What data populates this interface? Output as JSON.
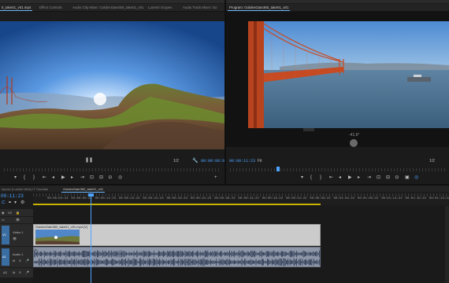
{
  "tabs_left": [
    {
      "label": "0_take01_v01.mp4",
      "active": true
    },
    {
      "label": "Effect Controls",
      "active": false
    },
    {
      "label": "Audio Clip Mixer: GoldenGate360_take01_v01",
      "active": false
    },
    {
      "label": "Lumetri Scopes",
      "active": false
    },
    {
      "label": "Audio Track Mixer: Go",
      "active": false
    }
  ],
  "tab_program": "Program: GoldenGate360_take01_v01",
  "source": {
    "timecode": "00:00:08:09",
    "zoom": "1/2"
  },
  "program": {
    "angle": "-41.6°",
    "timecode": "00:00:11:23",
    "fit": "Fit",
    "zoom": "1/2"
  },
  "timeline": {
    "tabs": [
      {
        "label": "Ispose (Lumetri Web) IT Tutorials",
        "active": false
      },
      {
        "label": "GoldenGate360_take01_v01",
        "active": true
      }
    ],
    "timecode": "00:11:23",
    "ruler": [
      "00:00:04:23",
      "00:00:09:23",
      "00:00:14:23",
      "00:00:19:23",
      "00:00:24:23",
      "00:00:29:23",
      "00:00:34:23",
      "00:00:39:23",
      "00:00:44:22",
      "00:00:49:22",
      "00:00:54:22",
      "00:00:59:22",
      "00:01:04:22",
      "00:01:09:22",
      "00:01:14:22",
      "00:01:19:22",
      "00:01:24:22"
    ],
    "tracks": {
      "v2": "V2",
      "v1": "V1",
      "video1": "Video 1",
      "a1": "A1",
      "audio1": "Audio 1",
      "a2": "A2"
    },
    "clip_label": "GoldenGate360_take01_v01.mp4 [V]",
    "audio_clip_fx": "fx"
  },
  "colors": {
    "accent": "#4da3ff",
    "clip_video": "#cbcbcb",
    "clip_audio": "#8e97a8"
  }
}
